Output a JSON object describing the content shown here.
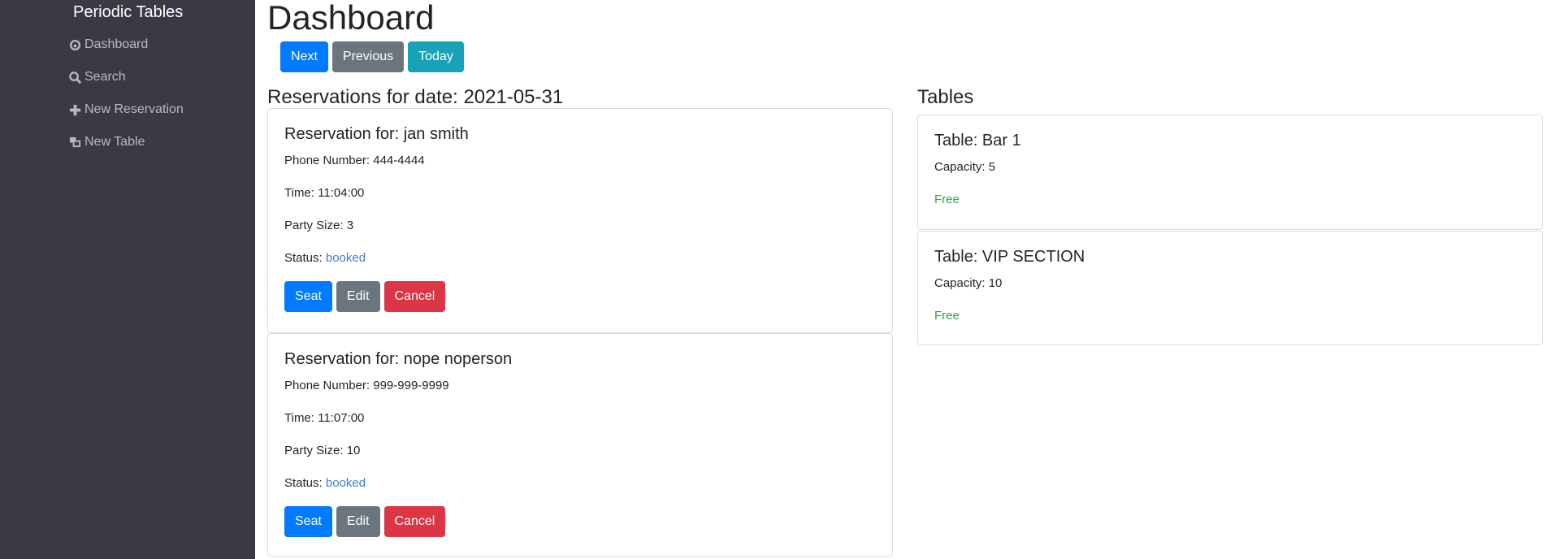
{
  "sidebar": {
    "brand": "Periodic Tables",
    "items": [
      {
        "label": "Dashboard",
        "icon": "dashboard-icon"
      },
      {
        "label": "Search",
        "icon": "search-icon"
      },
      {
        "label": "New Reservation",
        "icon": "plus-icon"
      },
      {
        "label": "New Table",
        "icon": "table-icon"
      }
    ]
  },
  "header": {
    "title": "Dashboard",
    "next": "Next",
    "previous": "Previous",
    "today": "Today"
  },
  "reservations": {
    "heading": "Reservations for date: 2021-05-31",
    "items": [
      {
        "name": "Reservation for: jan smith",
        "phone_label": "Phone Number: ",
        "phone": "444-4444",
        "time_label": "Time: ",
        "time": "11:04:00",
        "party_label": "Party Size: ",
        "party": "3",
        "status_label": "Status: ",
        "status": "booked",
        "seat": "Seat",
        "edit": "Edit",
        "cancel": "Cancel"
      },
      {
        "name": "Reservation for: nope noperson",
        "phone_label": "Phone Number: ",
        "phone": "999-999-9999",
        "time_label": "Time: ",
        "time": "11:07:00",
        "party_label": "Party Size: ",
        "party": "10",
        "status_label": "Status: ",
        "status": "booked",
        "seat": "Seat",
        "edit": "Edit",
        "cancel": "Cancel"
      }
    ]
  },
  "tables": {
    "heading": "Tables",
    "items": [
      {
        "name": "Table: Bar 1",
        "capacity_label": "Capacity: ",
        "capacity": "5",
        "status": "Free"
      },
      {
        "name": "Table: VIP SECTION",
        "capacity_label": "Capacity: ",
        "capacity": "10",
        "status": "Free"
      }
    ]
  }
}
